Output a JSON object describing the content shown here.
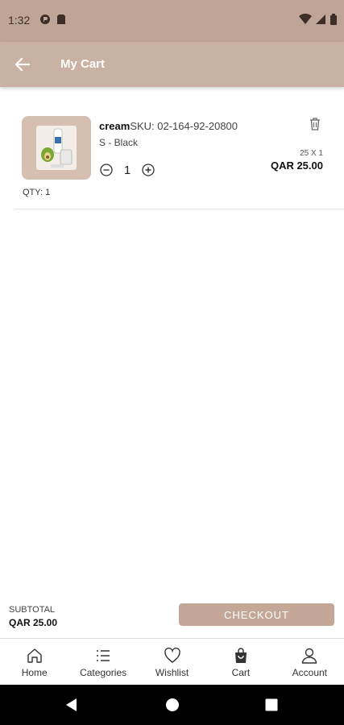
{
  "status_bar": {
    "time": "1:32"
  },
  "app_bar": {
    "title": "My Cart"
  },
  "cart": {
    "items": [
      {
        "name": "cream",
        "sku": "SKU: 02-164-92-20800",
        "variant": "S - Black",
        "quantity": "1",
        "qty_label": "QTY: 1",
        "unit_line": "25 X 1",
        "price": "QAR 25.00"
      }
    ]
  },
  "summary": {
    "subtotal_label": "SUBTOTAL",
    "subtotal_value": "QAR 25.00",
    "checkout_label": "CHECKOUT"
  },
  "bottom_nav": {
    "items": [
      {
        "label": "Home",
        "icon": "home-icon"
      },
      {
        "label": "Categories",
        "icon": "list-icon"
      },
      {
        "label": "Wishlist",
        "icon": "heart-icon"
      },
      {
        "label": "Cart",
        "icon": "cart-bag-icon"
      },
      {
        "label": "Account",
        "icon": "user-icon"
      }
    ]
  },
  "colors": {
    "status_bar": "#bfa597",
    "app_bar": "#c9b2a4",
    "checkout_button": "#c4a797"
  }
}
